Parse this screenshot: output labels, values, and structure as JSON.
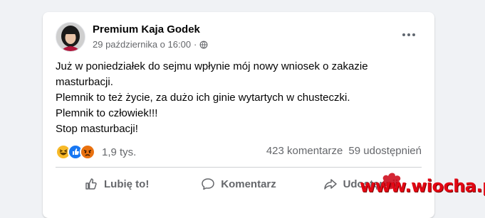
{
  "post": {
    "author": "Premium Kaja Godek",
    "timestamp": "29 października o 16:00",
    "separator": "·",
    "privacy_icon": "globe-icon",
    "more_icon": "more-options-icon",
    "text_lines": [
      "Już w poniedziałek do sejmu wpłynie mój nowy wniosek o zakazie",
      "masturbacji.",
      "Plemnik to też życie, za dużo ich ginie wytartych w chusteczki.",
      "Plemnik to człowiek!!!",
      "Stop masturbacji!"
    ]
  },
  "stats": {
    "reactions": [
      "haha-reaction-icon",
      "like-reaction-icon",
      "angry-reaction-icon"
    ],
    "reaction_count": "1,9 tys.",
    "comments": "423 komentarze",
    "shares": "59 udostępnień"
  },
  "actions": {
    "like": "Lubię to!",
    "comment": "Komentarz",
    "share": "Udostępnij"
  },
  "watermark": "www.wiocha.pl",
  "colors": {
    "background": "#f0f2f5",
    "card": "#ffffff",
    "text": "#050505",
    "secondary": "#65676b",
    "like_blue": "#1877f2",
    "haha_yellow": "#f7b928",
    "angry_orange": "#e9710f",
    "watermark_red": "#e30613"
  }
}
